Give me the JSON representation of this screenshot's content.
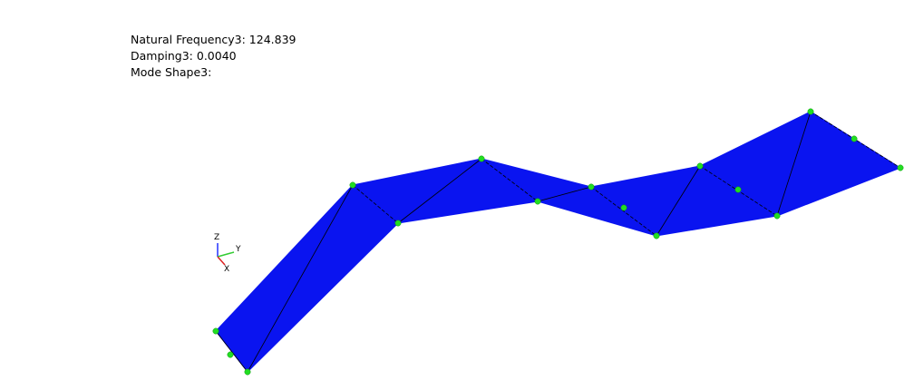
{
  "info": {
    "frequency": "Natural Frequency3: 124.839",
    "damping": "Damping3: 0.0040",
    "mode_shape": "Mode Shape3:"
  },
  "triad": {
    "z_label": "Z",
    "y_label": "Y",
    "x_label": "X"
  },
  "colors": {
    "surface": "#0a14f0",
    "edge": "#000000",
    "node": "#22dd22",
    "axis_z": "#2233ff",
    "axis_y": "#33cc33",
    "axis_x": "#dd2222"
  }
}
